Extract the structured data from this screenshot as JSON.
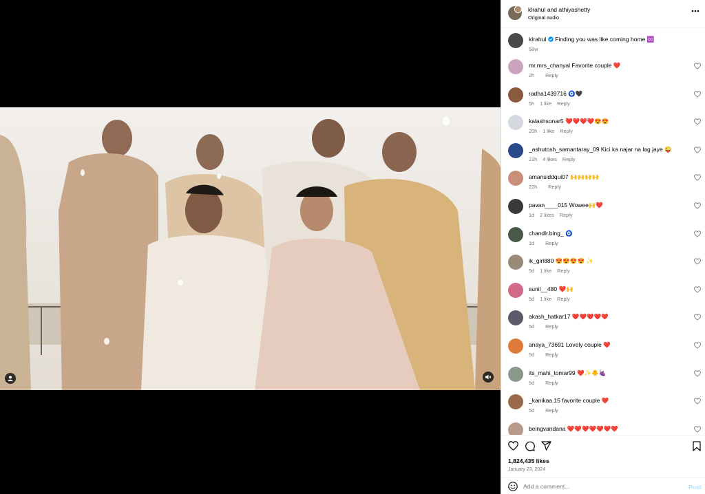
{
  "post": {
    "author_line": "klrahul and athiyashetty",
    "audio": "Original audio",
    "caption_user": "klrahul",
    "caption_text": "Finding you was like coming home ♾️",
    "caption_time": "58w",
    "likes": "1,824,435 likes",
    "date": "January 23, 2024"
  },
  "comments": [
    {
      "user": "mr.mrs_chanyal",
      "text": "Favorite couple ❤️",
      "time": "2h",
      "likes": "",
      "reply": "Reply",
      "avatar": "#c9a3c0"
    },
    {
      "user": "radha1439716",
      "text": "🧿🖤",
      "time": "5h",
      "likes": "1 like",
      "reply": "Reply",
      "avatar": "#8b5a3c"
    },
    {
      "user": "kalashsonar5",
      "text": "❤️❤️❤️❤️😍😍",
      "time": "20h",
      "likes": "1 like",
      "reply": "Reply",
      "avatar": "#d5d8de"
    },
    {
      "user": "_ashutosh_samantaray_09",
      "text": "Kici ka najar na lag jaye 😜",
      "time": "21h",
      "likes": "4 likes",
      "reply": "Reply",
      "avatar": "#2b4a8a"
    },
    {
      "user": "amansiddqui07",
      "text": "🙌🙌🙌🙌",
      "time": "22h",
      "likes": "",
      "reply": "Reply",
      "avatar": "#c98f7a"
    },
    {
      "user": "pavan____015",
      "text": "Wowee🙌❤️",
      "time": "1d",
      "likes": "2 likes",
      "reply": "Reply",
      "avatar": "#3a3a3a"
    },
    {
      "user": "chandlr.bing_",
      "text": "🧿",
      "time": "1d",
      "likes": "",
      "reply": "Reply",
      "avatar": "#4a5a4a"
    },
    {
      "user": "ik_girl880",
      "text": "😍😍😍😍 ✨",
      "time": "5d",
      "likes": "1 like",
      "reply": "Reply",
      "avatar": "#9a8a7a"
    },
    {
      "user": "sunil__480",
      "text": "❤️🙌",
      "time": "5d",
      "likes": "1 like",
      "reply": "Reply",
      "avatar": "#d46a8a"
    },
    {
      "user": "akash_hatkar17",
      "text": "❤️❤️❤️❤️❤️",
      "time": "5d",
      "likes": "",
      "reply": "Reply",
      "avatar": "#5a5a6a"
    },
    {
      "user": "anaya_73691",
      "text": "Lovely couple ❤️",
      "time": "5d",
      "likes": "",
      "reply": "Reply",
      "avatar": "#e07a3a"
    },
    {
      "user": "its_mahi_tomar99",
      "text": "❤️✨🐥🍇",
      "time": "5d",
      "likes": "",
      "reply": "Reply",
      "avatar": "#8a9a8a"
    },
    {
      "user": "_kanikaa.15",
      "text": "favorite couple ❤️",
      "time": "5d",
      "likes": "",
      "reply": "Reply",
      "avatar": "#9a6a4a"
    },
    {
      "user": "beingvandana",
      "text": "❤️❤️❤️❤️❤️❤️❤️",
      "time": "",
      "likes": "",
      "reply": "",
      "avatar": "#b89a8a"
    }
  ],
  "composer": {
    "placeholder": "Add a comment...",
    "post_label": "Post"
  },
  "icons": {
    "more": "more-horizontal-icon",
    "verified": "verified-badge-icon",
    "like": "heart-outline-icon",
    "comment": "comment-icon",
    "share": "send-icon",
    "save": "bookmark-icon",
    "emoji": "emoji-icon",
    "tag": "tagged-user-icon",
    "mute": "volume-muted-icon"
  },
  "colors": {
    "verified": "#0095f6",
    "muted_text": "#737373",
    "post_button": "#b2dffc"
  }
}
